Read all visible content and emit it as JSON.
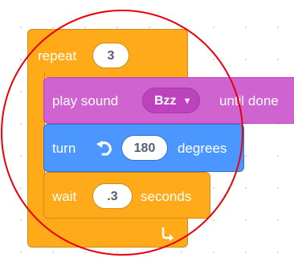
{
  "repeat": {
    "label": "repeat",
    "count": "3",
    "loop_icon": "loop-arrow-icon"
  },
  "play": {
    "label_prefix": "play sound",
    "sound": "Bzz",
    "label_suffix": "until done"
  },
  "turn": {
    "label_prefix": "turn",
    "icon": "rotate-left-icon",
    "value": "180",
    "label_suffix": "degrees"
  },
  "wait": {
    "label_prefix": "wait",
    "value": ".3",
    "label_suffix": "seconds"
  },
  "colors": {
    "control": "#ffab19",
    "sound": "#cf63cf",
    "motion": "#4c97ff",
    "annotation": "#e8000b"
  }
}
